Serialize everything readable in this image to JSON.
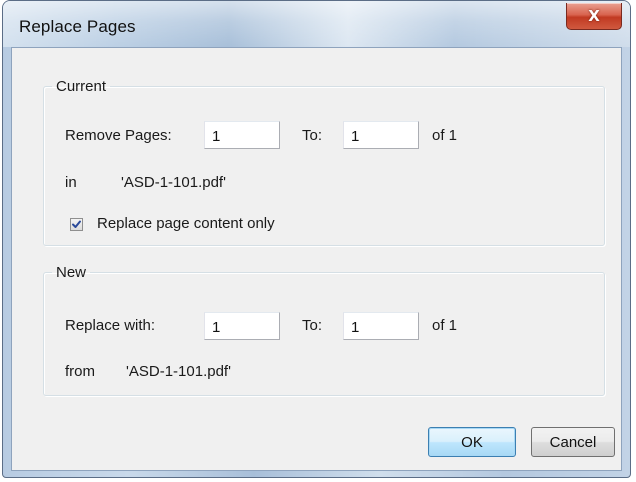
{
  "window": {
    "title": "Replace Pages",
    "close_glyph": "X"
  },
  "current": {
    "legend": "Current",
    "remove_pages_label": "Remove Pages:",
    "from_value": "1",
    "to_label": "To:",
    "to_value": "1",
    "of_text": "of 1",
    "in_label": "in",
    "file_name": "'ASD-1-101.pdf'",
    "replace_content_only_label": "Replace page content only",
    "replace_content_only_checked": true
  },
  "new": {
    "legend": "New",
    "replace_with_label": "Replace with:",
    "from_value": "1",
    "to_label": "To:",
    "to_value": "1",
    "of_text": "of 1",
    "from_label": "from",
    "file_name": "'ASD-1-101.pdf'"
  },
  "buttons": {
    "ok_label": "OK",
    "cancel_label": "Cancel"
  },
  "colors": {
    "close_button": "#c13a22",
    "default_button_border": "#3c7fb1",
    "dialog_background": "#f0f0f0"
  }
}
